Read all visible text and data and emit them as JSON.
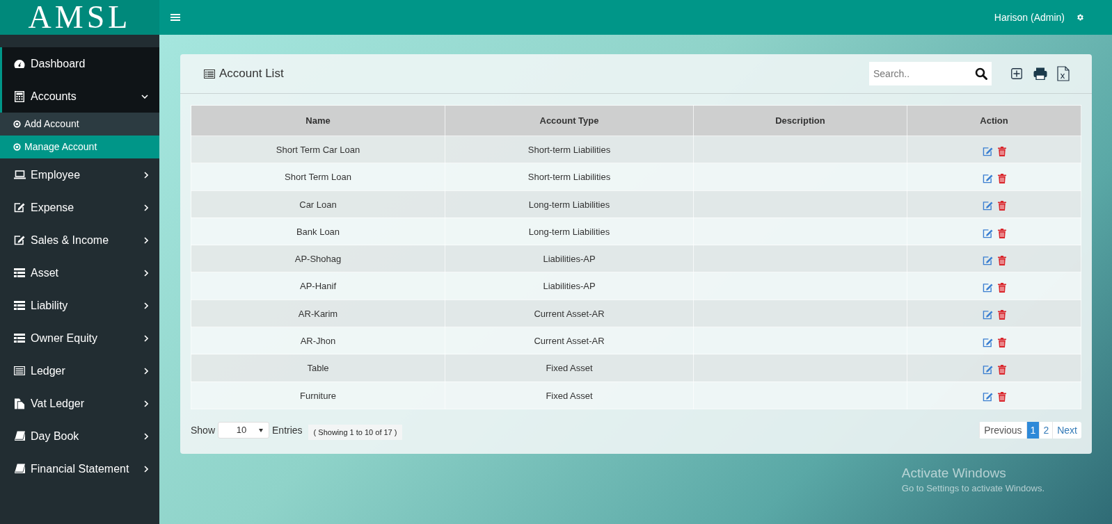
{
  "brand": {
    "logo": "AMSL"
  },
  "header": {
    "user": "Harison (Admin)"
  },
  "sidebar": {
    "items": [
      {
        "label": "Dashboard",
        "active": true
      },
      {
        "label": "Accounts",
        "active": true,
        "expanded": true,
        "children": [
          {
            "label": "Add Account",
            "selected": false
          },
          {
            "label": "Manage Account",
            "selected": true
          }
        ]
      },
      {
        "label": "Employee",
        "active": false,
        "expanded": false
      },
      {
        "label": "Expense",
        "active": false,
        "expanded": false
      },
      {
        "label": "Sales & Income",
        "active": false,
        "expanded": false
      },
      {
        "label": "Asset",
        "active": false,
        "expanded": false
      },
      {
        "label": "Liability",
        "active": false,
        "expanded": false
      },
      {
        "label": "Owner Equity",
        "active": false,
        "expanded": false
      },
      {
        "label": "Ledger",
        "active": false,
        "expanded": false
      },
      {
        "label": "Vat Ledger",
        "active": false,
        "expanded": false
      },
      {
        "label": "Day Book",
        "active": false,
        "expanded": false
      },
      {
        "label": "Financial Statement",
        "active": false,
        "expanded": false
      }
    ]
  },
  "card": {
    "title": "Account List",
    "search": {
      "placeholder": "Search.."
    }
  },
  "table": {
    "columns": [
      "Name",
      "Account Type",
      "Description",
      "Action"
    ],
    "rows": [
      {
        "name": "Short Term Car Loan",
        "account_type": "Short-term Liabilities"
      },
      {
        "name": "Short Term Loan",
        "account_type": "Short-term Liabilities"
      },
      {
        "name": "Car Loan",
        "account_type": "Long-term Liabilities"
      },
      {
        "name": "Bank Loan",
        "account_type": "Long-term Liabilities"
      },
      {
        "name": "AP-Shohag",
        "account_type": "Liabilities-AP"
      },
      {
        "name": "AP-Hanif",
        "account_type": "Liabilities-AP"
      },
      {
        "name": "AR-Karim",
        "account_type": "Current Asset-AR"
      },
      {
        "name": "AR-Jhon",
        "account_type": "Current Asset-AR"
      },
      {
        "name": "Table",
        "account_type": "Fixed Asset"
      },
      {
        "name": "Furniture",
        "account_type": "Fixed Asset"
      }
    ]
  },
  "footer": {
    "show_label": "Show",
    "page_size": "10",
    "entries_label": "Entries",
    "summary": "( Showing 1 to 10 of 17 )",
    "pagination": [
      {
        "label": "Previous",
        "kind": "nav",
        "selected": false
      },
      {
        "label": "1",
        "kind": "page",
        "selected": true
      },
      {
        "label": "2",
        "kind": "page",
        "selected": false
      },
      {
        "label": "Next",
        "kind": "nav",
        "selected": false
      }
    ]
  },
  "windows_notice": {
    "title": "Activate Windows",
    "subtitle": "Go to Settings to activate Windows."
  }
}
